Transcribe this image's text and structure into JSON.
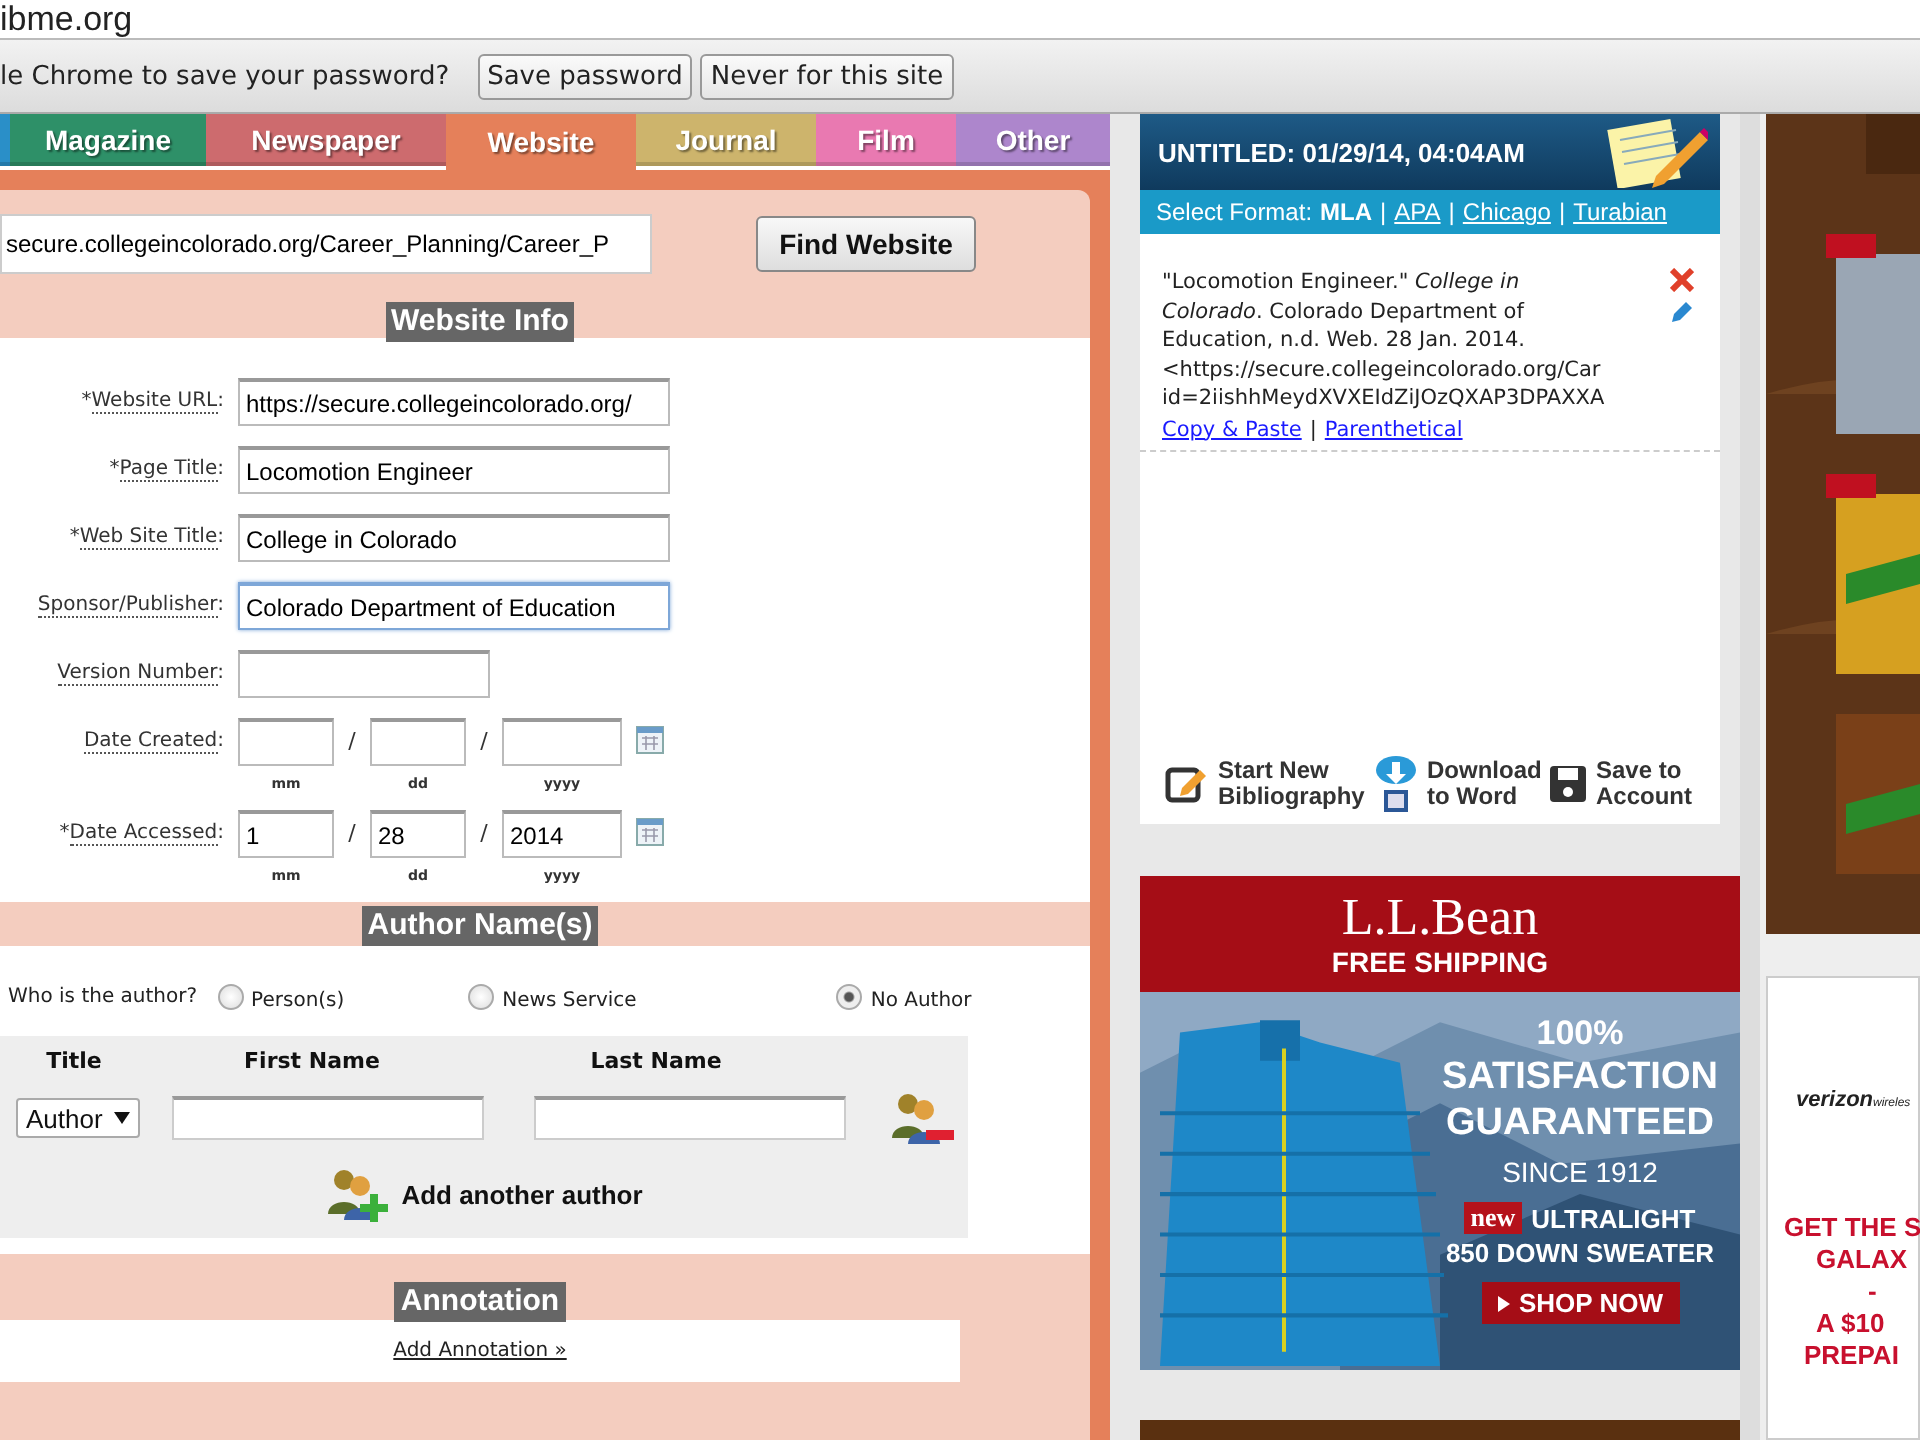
{
  "address_bar": {
    "url": "ibme.org"
  },
  "password_prompt": {
    "message": "le Chrome to save your password?",
    "buttons": [
      "Save password",
      "Never for this site"
    ]
  },
  "tabs": [
    {
      "color": "#2a8fc8",
      "selected": false
    },
    {
      "label": "Magazine",
      "color": "#2e9068",
      "selected": false
    },
    {
      "label": "Newspaper",
      "color": "#cd6b6e",
      "selected": false
    },
    {
      "label": "Website",
      "color": "#e5805a",
      "selected": true
    },
    {
      "label": "Journal",
      "color": "#cdb46c",
      "selected": false
    },
    {
      "label": "Film",
      "color": "#e979b1",
      "selected": false
    },
    {
      "label": "Other",
      "color": "#ad86cc",
      "selected": false
    }
  ],
  "url_search": {
    "value": "secure.collegeincolorado.org/Career_Planning/Career_P",
    "button": "Find Website"
  },
  "website_info": {
    "heading": "Website Info",
    "fields": [
      {
        "kind": "text",
        "mark": "*",
        "label": "Website URL",
        "suffix": ":",
        "value": "https://secure.collegeincolorado.org/",
        "focused": false
      },
      {
        "kind": "text",
        "mark": "*",
        "label": "Page Title",
        "suffix": ":",
        "value": "Locomotion Engineer",
        "focused": false
      },
      {
        "kind": "text",
        "mark": "*",
        "label": "Web Site Title",
        "suffix": ":",
        "value": "College in Colorado",
        "focused": false
      },
      {
        "kind": "text",
        "label": "Sponsor/Publisher",
        "suffix": ":",
        "value": "Colorado Department of Education",
        "focused": true
      },
      {
        "kind": "short_text",
        "label": "Version Number",
        "suffix": ":",
        "focused": false
      },
      {
        "kind": "date",
        "label": "Date Created",
        "suffix": ":",
        "separator": "/",
        "parts": [
          {
            "hint": "mm"
          },
          {
            "hint": "dd"
          },
          {
            "hint": "yyyy"
          }
        ]
      },
      {
        "kind": "date",
        "mark": "*",
        "label": "Date Accessed",
        "suffix": ":",
        "separator": "/",
        "parts": [
          {
            "value": "1",
            "hint": "mm"
          },
          {
            "value": "28",
            "hint": "dd"
          },
          {
            "value": "2014",
            "hint": "yyyy"
          }
        ]
      }
    ]
  },
  "author_section": {
    "heading": "Author Name(s)",
    "question": "Who is the author?",
    "options": [
      {
        "label": "Person(s)",
        "selected": false
      },
      {
        "label": "News Service",
        "selected": false
      },
      {
        "label": "No Author",
        "selected": true
      }
    ],
    "columns": [
      "Title",
      "First Name",
      "Last Name"
    ],
    "title_select": "Author",
    "add_author": "Add another author"
  },
  "annotation": {
    "heading": "Annotation",
    "link": "Add Annotation »"
  },
  "bibliography": {
    "title": "UNTITLED: 01/29/14, 04:04AM",
    "format_label": "Select Format:",
    "formats": [
      {
        "label": "MLA",
        "selected": true
      },
      {
        "label": "APA",
        "selected": false
      },
      {
        "label": "Chicago",
        "selected": false
      },
      {
        "label": "Turabian",
        "selected": false
      }
    ],
    "citation_lines": [
      "\"Locomotion Engineer.\" *College in*",
      "*Colorado*. Colorado Department of",
      "Education, n.d. Web. 28 Jan. 2014.",
      "<https://secure.collegeincolorado.org/Car",
      "id=2iishhMeydXVXEIdZiJOzQXAP3DPAXXA"
    ],
    "separator": "|",
    "links": [
      "Copy & Paste",
      "Parenthetical"
    ],
    "actions": [
      {
        "kind": "new",
        "lines": [
          "Start New",
          "Bibliography"
        ]
      },
      {
        "kind": "download",
        "lines": [
          "Download",
          "to Word"
        ]
      },
      {
        "kind": "save",
        "lines": [
          "Save to",
          "Account"
        ]
      }
    ]
  },
  "ad_banner": {
    "brand": "L.L.Bean",
    "tagline": "FREE SHIPPING",
    "headline": [
      "100%",
      "SATISFACTION",
      "GUARANTEED"
    ],
    "since": "SINCE 1912",
    "badge": "new",
    "product": [
      "ULTRALIGHT",
      "850 DOWN SWEATER"
    ],
    "cta": "SHOP NOW"
  },
  "side_ad": {
    "logo": "verizon",
    "logo_suffix": "wireles",
    "lines": [
      "GET THE S",
      "GALAX",
      "-",
      "A $10",
      "PREPAI"
    ]
  }
}
